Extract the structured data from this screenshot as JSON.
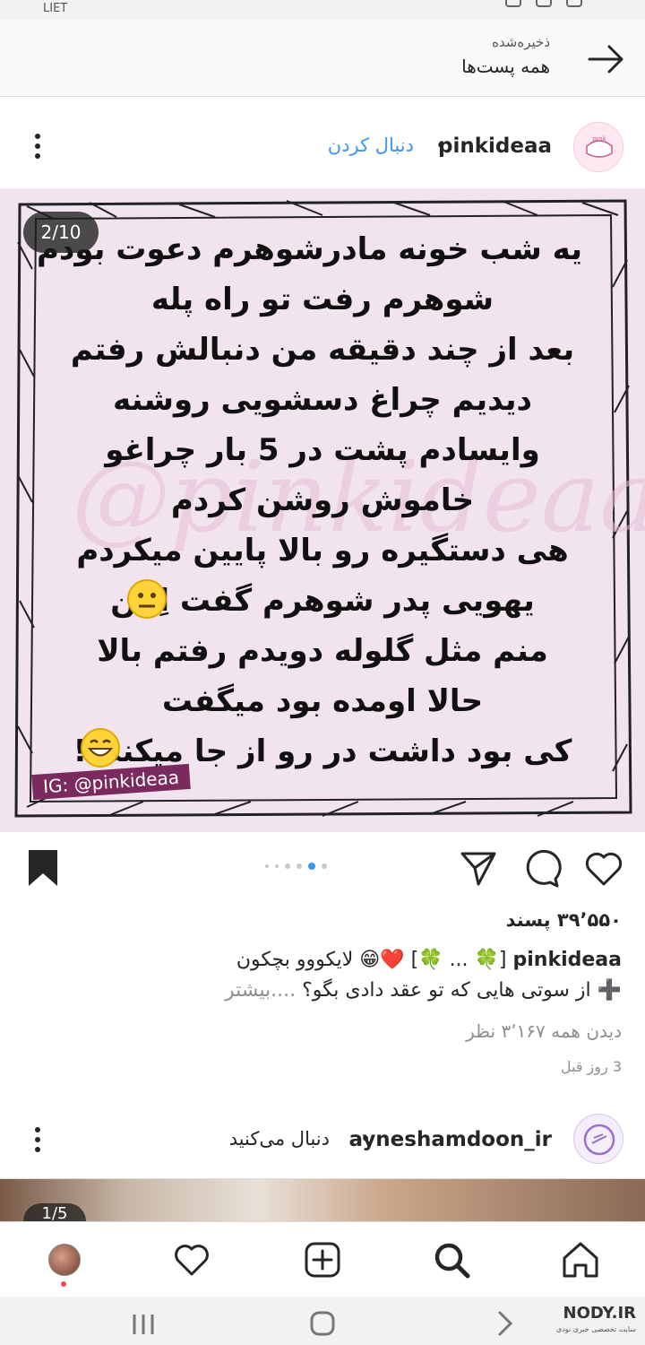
{
  "status_bar": {
    "left_text": "LIET"
  },
  "saved_header": {
    "subtitle": "ذخیره‌شده",
    "title": "همه پست‌ها"
  },
  "post": {
    "username": "pinkideaa",
    "separator": "•",
    "follow_label": "دنبال کردن",
    "carousel_counter": "2/10",
    "image_lines": [
      "یه شب خونه مادرشوهرم دعوت بودم",
      "شوهرم رفت تو راه پله",
      "بعد از چند دقیقه من دنبالش رفتم",
      "دیدیم چراغ دسشویی روشنه",
      "وایسادم پشت در 5 بار چراغو",
      "خاموش روشن کردم",
      "هی دستگیره رو بالا پایین میکردم",
      "یهویی پدر شوهرم گفت اِهن",
      "منم مثل گلوله دویدم رفتم بالا",
      "حالا اومده بود میگفت",
      "کی بود داشت در رو از جا میکند؟!"
    ],
    "watermark": "@pinkideaa",
    "ig_tag": "IG: @pinkideaa",
    "likes": "۳۹٬۵۵۰ پسند",
    "caption_user": "pinkideaa",
    "caption_text": "[🍀 ... 🍀] ❤️😁 لایکووو بچکون",
    "caption_line2": "➕ از سوتی هایی که تو عقد دادی بگو؟",
    "caption_more": "....بیشتر",
    "views": "دیدن همه ۳٬۱۶۷ نظر",
    "time": "3 روز قبل",
    "carousel_total_dots": 6,
    "carousel_active_dot": 5
  },
  "post2": {
    "username": "ayneshamdoon_ir",
    "separator": "•",
    "following_label": "دنبال می‌کنید",
    "carousel_counter": "1/5"
  },
  "bottom_nav": {
    "items": [
      "profile",
      "activity",
      "new-post",
      "search",
      "home"
    ]
  },
  "system_nav": {
    "brand": "NODY.IR",
    "brand_sub": "سایت تخصصی خبری نودی"
  },
  "colors": {
    "link_blue": "#3897f0",
    "image_bg": "#f1e4ee",
    "tag_bg": "#7a2a5d",
    "badge_red": "#ed4956"
  }
}
